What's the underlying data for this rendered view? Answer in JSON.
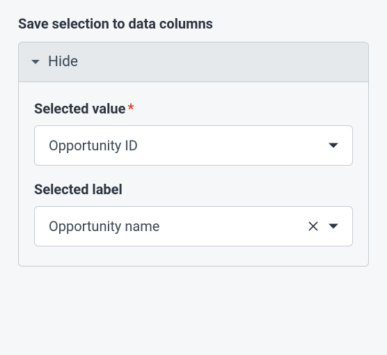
{
  "section_title": "Save selection to data columns",
  "panel": {
    "header_label": "Hide",
    "fields": {
      "selected_value": {
        "label": "Selected value",
        "required_mark": "*",
        "value": "Opportunity ID"
      },
      "selected_label": {
        "label": "Selected label",
        "value": "Opportunity name"
      }
    }
  }
}
